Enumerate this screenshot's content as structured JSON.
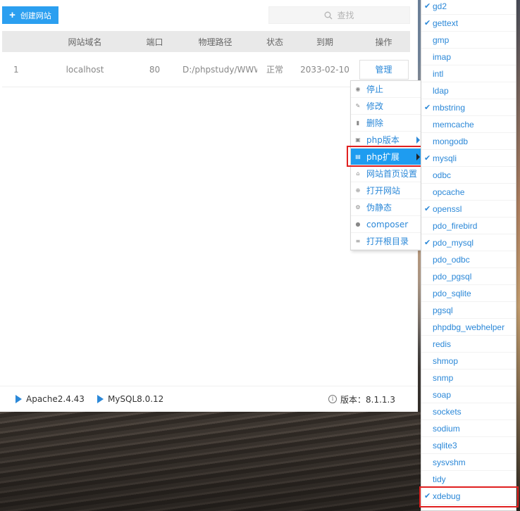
{
  "toolbar": {
    "create_label": "创建网站",
    "search_placeholder": "查找"
  },
  "table": {
    "headers": [
      "网站域名",
      "端口",
      "物理路径",
      "状态",
      "到期",
      "操作"
    ],
    "rows": [
      {
        "index": "1",
        "domain": "localhost",
        "port": "80",
        "path": "D:/phpstudy/WWW...",
        "status": "正常",
        "expiry": "2033-02-10",
        "action": "管理"
      }
    ]
  },
  "context_menu": {
    "items": [
      {
        "label": "停止",
        "icon": "stop-icon"
      },
      {
        "label": "修改",
        "icon": "edit-icon"
      },
      {
        "label": "删除",
        "icon": "trash-icon"
      },
      {
        "label": "php版本",
        "icon": "php-version-icon"
      },
      {
        "label": "php扩展",
        "icon": "php-extension-icon"
      },
      {
        "label": "网站首页设置",
        "icon": "home-icon"
      },
      {
        "label": "打开网站",
        "icon": "globe-icon"
      },
      {
        "label": "伪静态",
        "icon": "rewrite-icon"
      },
      {
        "label": "composer",
        "icon": "composer-icon"
      },
      {
        "label": "打开根目录",
        "icon": "folder-list-icon"
      }
    ]
  },
  "extensions": [
    {
      "name": "gd2",
      "enabled": true
    },
    {
      "name": "gettext",
      "enabled": true
    },
    {
      "name": "gmp",
      "enabled": false
    },
    {
      "name": "imap",
      "enabled": false
    },
    {
      "name": "intl",
      "enabled": false
    },
    {
      "name": "ldap",
      "enabled": false
    },
    {
      "name": "mbstring",
      "enabled": true
    },
    {
      "name": "memcache",
      "enabled": false
    },
    {
      "name": "mongodb",
      "enabled": false
    },
    {
      "name": "mysqli",
      "enabled": true
    },
    {
      "name": "odbc",
      "enabled": false
    },
    {
      "name": "opcache",
      "enabled": false
    },
    {
      "name": "openssl",
      "enabled": true
    },
    {
      "name": "pdo_firebird",
      "enabled": false
    },
    {
      "name": "pdo_mysql",
      "enabled": true
    },
    {
      "name": "pdo_odbc",
      "enabled": false
    },
    {
      "name": "pdo_pgsql",
      "enabled": false
    },
    {
      "name": "pdo_sqlite",
      "enabled": false
    },
    {
      "name": "pgsql",
      "enabled": false
    },
    {
      "name": "phpdbg_webhelper",
      "enabled": false
    },
    {
      "name": "redis",
      "enabled": false
    },
    {
      "name": "shmop",
      "enabled": false
    },
    {
      "name": "snmp",
      "enabled": false
    },
    {
      "name": "soap",
      "enabled": false
    },
    {
      "name": "sockets",
      "enabled": false
    },
    {
      "name": "sodium",
      "enabled": false
    },
    {
      "name": "sqlite3",
      "enabled": false
    },
    {
      "name": "sysvshm",
      "enabled": false
    },
    {
      "name": "tidy",
      "enabled": false
    },
    {
      "name": "xdebug",
      "enabled": true
    }
  ],
  "status_bar": {
    "apache": "Apache2.4.43",
    "mysql": "MySQL8.0.12",
    "version": "版本：8.1.1.3"
  },
  "colors": {
    "accent": "#2b9ff0",
    "link": "#2b88d8",
    "highlight": "#e02020"
  }
}
